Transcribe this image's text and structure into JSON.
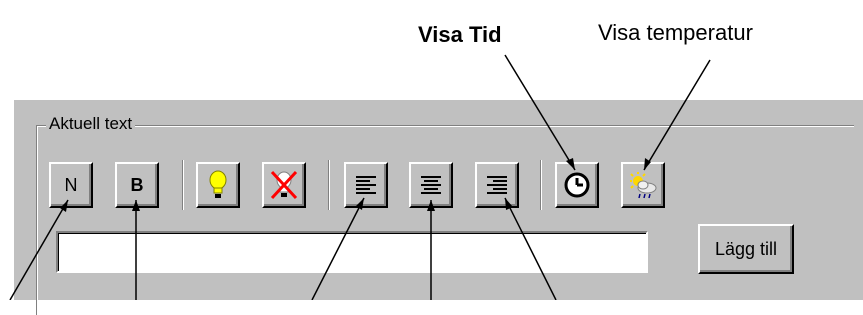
{
  "callouts": {
    "show_time": "Visa Tid",
    "show_temperature": "Visa temperatur"
  },
  "group": {
    "title": "Aktuell text"
  },
  "toolbar": {
    "normal_label": "N",
    "bold_label": "B"
  },
  "input": {
    "value": ""
  },
  "add_button": {
    "label": "Lägg till"
  },
  "colors": {
    "panel_bg": "#c0c0c0",
    "bulb_yellow": "#ffff00",
    "delete_red": "#ff0000",
    "sun_yellow": "#ffd800"
  },
  "icons": [
    "light-bulb-icon",
    "light-off-icon",
    "align-left-icon",
    "align-center-icon",
    "align-right-icon",
    "clock-icon",
    "weather-icon"
  ]
}
